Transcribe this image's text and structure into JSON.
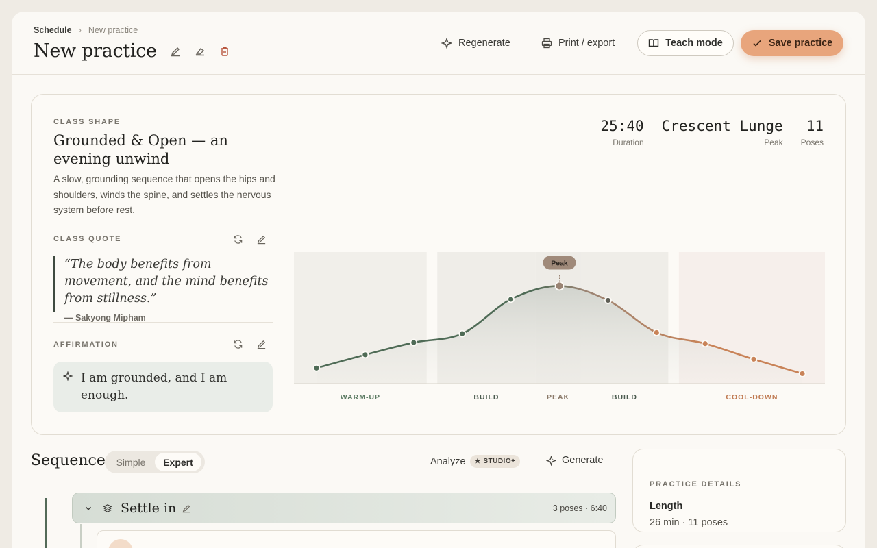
{
  "breadcrumb": {
    "parent": "Schedule",
    "current": "New practice"
  },
  "page_title": "New practice",
  "toolbar": {
    "regenerate": "Regenerate",
    "print": "Print / export",
    "teach": "Teach mode",
    "save": "Save practice"
  },
  "class_shape": {
    "label": "CLASS SHAPE",
    "title": "Grounded & Open — an evening unwind",
    "description": "A slow, grounding sequence that opens the hips and shoulders, winds the spine, and settles the nervous system before rest."
  },
  "quote": {
    "label": "CLASS QUOTE",
    "text": "“The body benefits from movement, and the mind benefits from stillness.”",
    "author": "— Sakyong Mipham"
  },
  "affirmation": {
    "label": "AFFIRMATION",
    "text": "I am grounded, and I am enough."
  },
  "stats": [
    {
      "value": "25:40",
      "label": "Duration"
    },
    {
      "value": "Crescent Lunge",
      "label": "Peak"
    },
    {
      "value": "11",
      "label": "Poses"
    }
  ],
  "chart_data": {
    "type": "line",
    "title": "",
    "xlabel": "",
    "ylabel": "",
    "x": [
      1,
      2,
      3,
      4,
      5,
      6,
      7,
      8,
      9,
      10,
      11
    ],
    "values": [
      0.14,
      0.26,
      0.37,
      0.45,
      0.76,
      0.88,
      0.75,
      0.46,
      0.36,
      0.22,
      0.09
    ],
    "ylim": [
      0,
      1
    ],
    "peak_index": 5,
    "peak_label": "Peak",
    "phases": [
      {
        "label": "WARM-UP",
        "start": 0.0,
        "end": 0.25,
        "color": "#5b7a62"
      },
      {
        "label": "BUILD",
        "start": 0.27,
        "end": 0.455,
        "color": "#4a5a4e"
      },
      {
        "label": "PEAK",
        "start": 0.455,
        "end": 0.54,
        "color": "#8b7a6a"
      },
      {
        "label": "BUILD",
        "start": 0.54,
        "end": 0.705,
        "color": "#4a5a4e"
      },
      {
        "label": "COOL-DOWN",
        "start": 0.725,
        "end": 1.0,
        "color": "#c07a52"
      }
    ],
    "colors": {
      "warm": "#4f6b56",
      "peak": "#9a8474",
      "cool": "#c98358"
    }
  },
  "sequence": {
    "title": "Sequence",
    "mode_simple": "Simple",
    "mode_expert": "Expert",
    "analyze": "Analyze",
    "analyze_badge": "★ STUDIO+",
    "generate": "Generate",
    "group_title": "Settle in",
    "group_meta": "3 poses · 6:40"
  },
  "details": {
    "label": "PRACTICE DETAILS",
    "length_key": "Length",
    "length_value": "26 min · 11 poses"
  }
}
